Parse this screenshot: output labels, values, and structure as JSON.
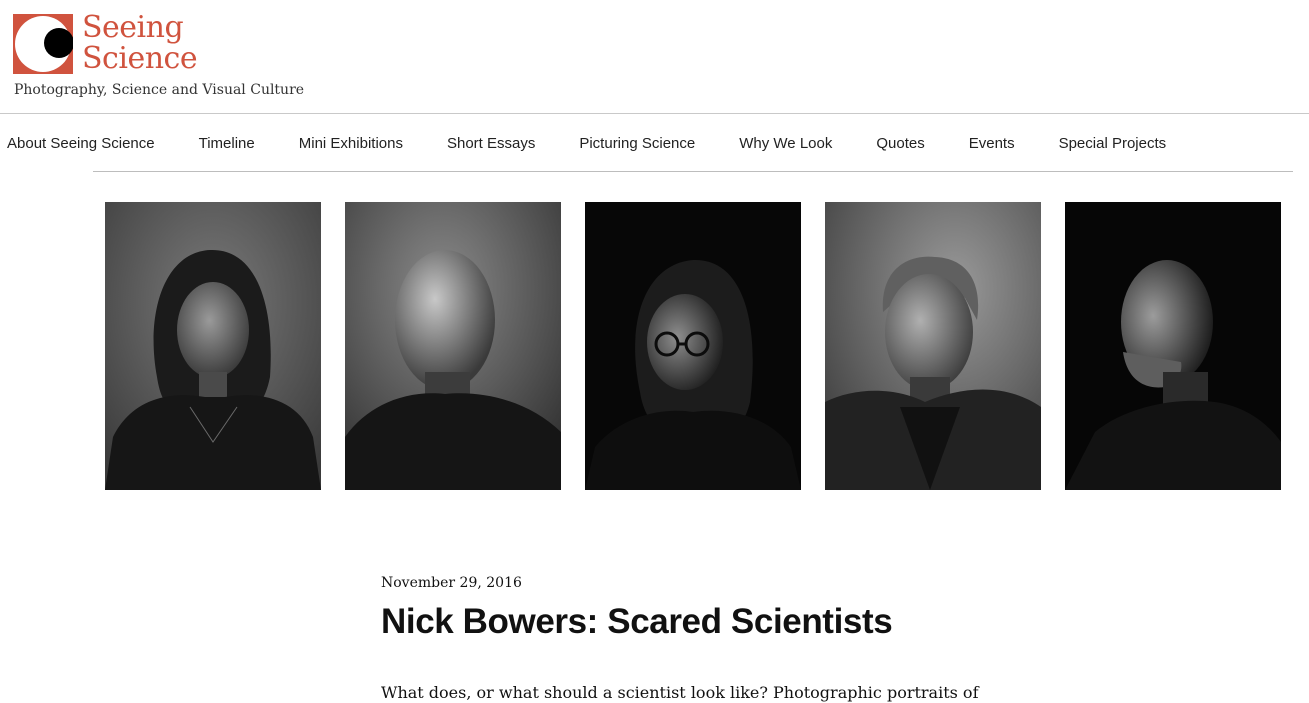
{
  "site": {
    "title_line1": "Seeing",
    "title_line2": "Science",
    "tagline": "Photography, Science and Visual Culture",
    "brand_color": "#d0533e"
  },
  "nav": {
    "items": [
      {
        "label": "About Seeing Science"
      },
      {
        "label": "Timeline"
      },
      {
        "label": "Mini Exhibitions"
      },
      {
        "label": "Short Essays"
      },
      {
        "label": "Picturing Science"
      },
      {
        "label": "Why We Look"
      },
      {
        "label": "Quotes"
      },
      {
        "label": "Events"
      },
      {
        "label": "Special Projects"
      }
    ]
  },
  "portraits": [
    {
      "subject": "woman-with-dark-hair",
      "background": "gray"
    },
    {
      "subject": "bald-man",
      "background": "gray"
    },
    {
      "subject": "woman-with-glasses",
      "background": "black"
    },
    {
      "subject": "man-with-gray-hair",
      "background": "gray"
    },
    {
      "subject": "man-with-beard-profile",
      "background": "black"
    }
  ],
  "post": {
    "date": "November 29, 2016",
    "title": "Nick Bowers: Scared Scientists",
    "excerpt": "What does, or what should a scientist look like? Photographic portraits of"
  }
}
